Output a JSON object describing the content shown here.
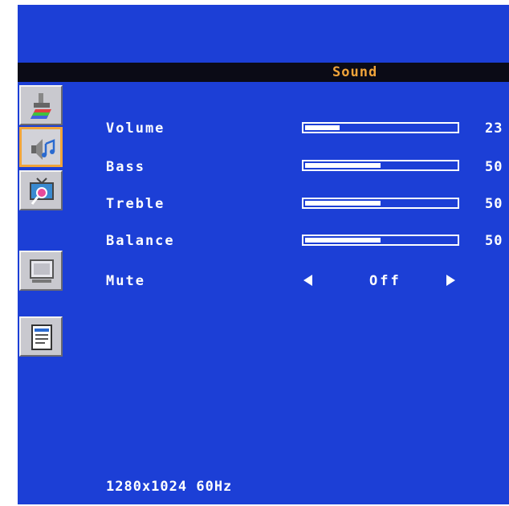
{
  "menu": {
    "title": "Sound"
  },
  "colors": {
    "background": "#1c3fd6",
    "title_bar": "#0b0b16",
    "title_text": "#f0a43a",
    "highlight": "#f0a43a"
  },
  "tabs": [
    {
      "name": "picture-tab",
      "icon": "paintbrush-icon",
      "active": false
    },
    {
      "name": "sound-tab",
      "icon": "speaker-music-icon",
      "active": true
    },
    {
      "name": "tv-tab",
      "icon": "tv-search-icon",
      "active": false
    },
    {
      "name": "monitor-tab",
      "icon": "monitor-icon",
      "active": false
    },
    {
      "name": "menu-tab",
      "icon": "document-icon",
      "active": false
    }
  ],
  "settings": [
    {
      "label": "Volume",
      "value": "23",
      "level": 23
    },
    {
      "label": "Bass",
      "value": "50",
      "level": 50
    },
    {
      "label": "Treble",
      "value": "50",
      "level": 50
    },
    {
      "label": "Balance",
      "value": "50",
      "level": 50
    }
  ],
  "mute": {
    "label": "Mute",
    "value": "Off"
  },
  "status": {
    "resolution": "1280x1024 60Hz"
  }
}
